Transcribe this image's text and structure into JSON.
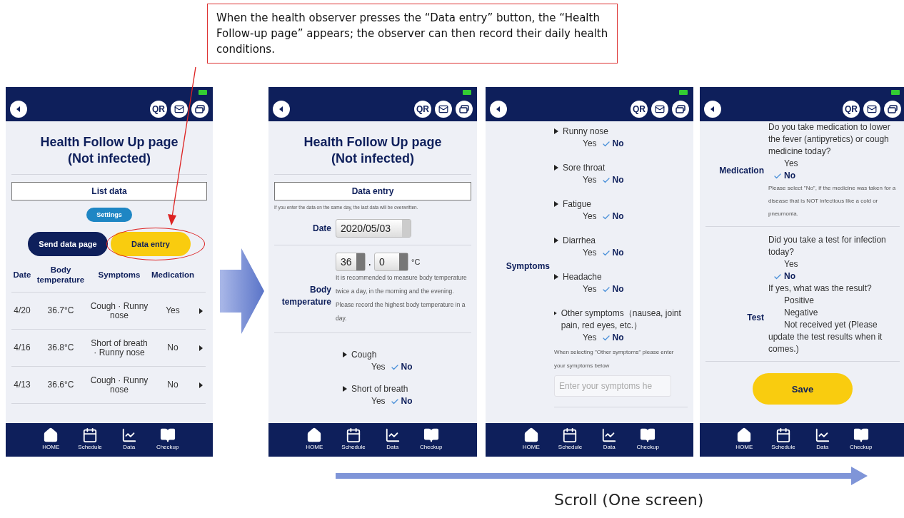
{
  "callout": {
    "text": "When the health observer presses the “Data entry” button, the “Health Follow-up page” appears; the observer can then record their daily health conditions."
  },
  "phones": [
    {
      "kind": "list",
      "qr": "QR",
      "title": "Health Follow Up page",
      "subtitle": "(Not infected)",
      "section": "List data",
      "settings": "Settings",
      "buttons": [
        {
          "label": "Send data page",
          "kind": "primary",
          "highlighted": false
        },
        {
          "label": "Data entry",
          "kind": "accent",
          "highlighted": true
        }
      ],
      "columns": [
        "Date",
        "Body temperature",
        "Symptoms",
        "Medication"
      ],
      "rows": [
        {
          "date": "4/20",
          "temp": "36.7°C",
          "symptoms": "Cough · Runny nose",
          "medication": "Yes"
        },
        {
          "date": "4/16",
          "temp": "36.8°C",
          "symptoms": "Short of breath · Runny nose",
          "medication": "No"
        },
        {
          "date": "4/13",
          "temp": "36.6°C",
          "symptoms": "Cough · Runny nose",
          "medication": "No"
        }
      ],
      "tabs": [
        "HOME",
        "Schedule",
        "Data",
        "Checkup"
      ]
    },
    {
      "kind": "entry",
      "qr": "QR",
      "title": "Health Follow Up page",
      "subtitle": "(Not infected)",
      "section": "Data entry",
      "note": "If you enter the data on the same day, the last data will be overwritten.",
      "date_label": "Date",
      "date_value": "2020/05/03",
      "temp_label": "Body temperature",
      "temp_whole": "36",
      "temp_sep": ".",
      "temp_decimal": "0",
      "temp_unit": "°C",
      "temp_hint": "It is recommended to measure body temperature twice a day, in the morning and the evening. Please record the highest body temperature in a day.",
      "symptoms": [
        {
          "name": "Cough",
          "options": [
            {
              "label": "Yes",
              "selected": false
            },
            {
              "label": "No",
              "selected": true
            }
          ]
        },
        {
          "name": "Short of breath",
          "options": [
            {
              "label": "Yes",
              "selected": false
            },
            {
              "label": "No",
              "selected": true
            }
          ]
        }
      ],
      "tabs": [
        "HOME",
        "Schedule",
        "Data",
        "Checkup"
      ]
    },
    {
      "kind": "symptoms",
      "qr": "QR",
      "label": "Symptoms",
      "symptoms": [
        {
          "name": "Runny nose",
          "options": [
            {
              "label": "Yes",
              "selected": false
            },
            {
              "label": "No",
              "selected": true
            }
          ]
        },
        {
          "name": "Sore throat",
          "options": [
            {
              "label": "Yes",
              "selected": false
            },
            {
              "label": "No",
              "selected": true
            }
          ]
        },
        {
          "name": "Fatigue",
          "options": [
            {
              "label": "Yes",
              "selected": false
            },
            {
              "label": "No",
              "selected": true
            }
          ]
        },
        {
          "name": "Diarrhea",
          "options": [
            {
              "label": "Yes",
              "selected": false
            },
            {
              "label": "No",
              "selected": true
            }
          ]
        },
        {
          "name": "Headache",
          "options": [
            {
              "label": "Yes",
              "selected": false
            },
            {
              "label": "No",
              "selected": true
            }
          ]
        },
        {
          "name": "Other symptoms（nausea, joint pain, red eyes, etc.）",
          "options": [
            {
              "label": "Yes",
              "selected": false
            },
            {
              "label": "No",
              "selected": true
            }
          ]
        }
      ],
      "note": "When selecting \"Other symptoms\" please enter your symptoms below",
      "placeholder": "Enter your symptoms he",
      "tabs": [
        "HOME",
        "Schedule",
        "Data",
        "Checkup"
      ]
    },
    {
      "kind": "questions",
      "qr": "QR",
      "medication": {
        "label": "Medication",
        "question": "Do you take medication to lower the fever (antipyretics) or cough medicine today?",
        "options": [
          {
            "label": "Yes",
            "selected": false
          },
          {
            "label": "No",
            "selected": true
          }
        ],
        "note": "Please select \"No\", if the medicine was taken for a disease that is NOT infectious like a cold or pneumonia."
      },
      "test": {
        "label": "Test",
        "question": "Did you take a test for infection today?",
        "options": [
          {
            "label": "Yes",
            "selected": false
          },
          {
            "label": "No",
            "selected": true
          }
        ],
        "result_question": "If yes, what was the result?",
        "results": [
          {
            "label": "Positive",
            "selected": false
          },
          {
            "label": "Negative",
            "selected": false
          },
          {
            "label": "Not received yet (Please update the test results when it comes.)",
            "selected": false
          }
        ]
      },
      "save": "Save",
      "tabs": [
        "HOME",
        "Schedule",
        "Data",
        "Checkup"
      ]
    }
  ],
  "caption": "Scroll (One screen)"
}
